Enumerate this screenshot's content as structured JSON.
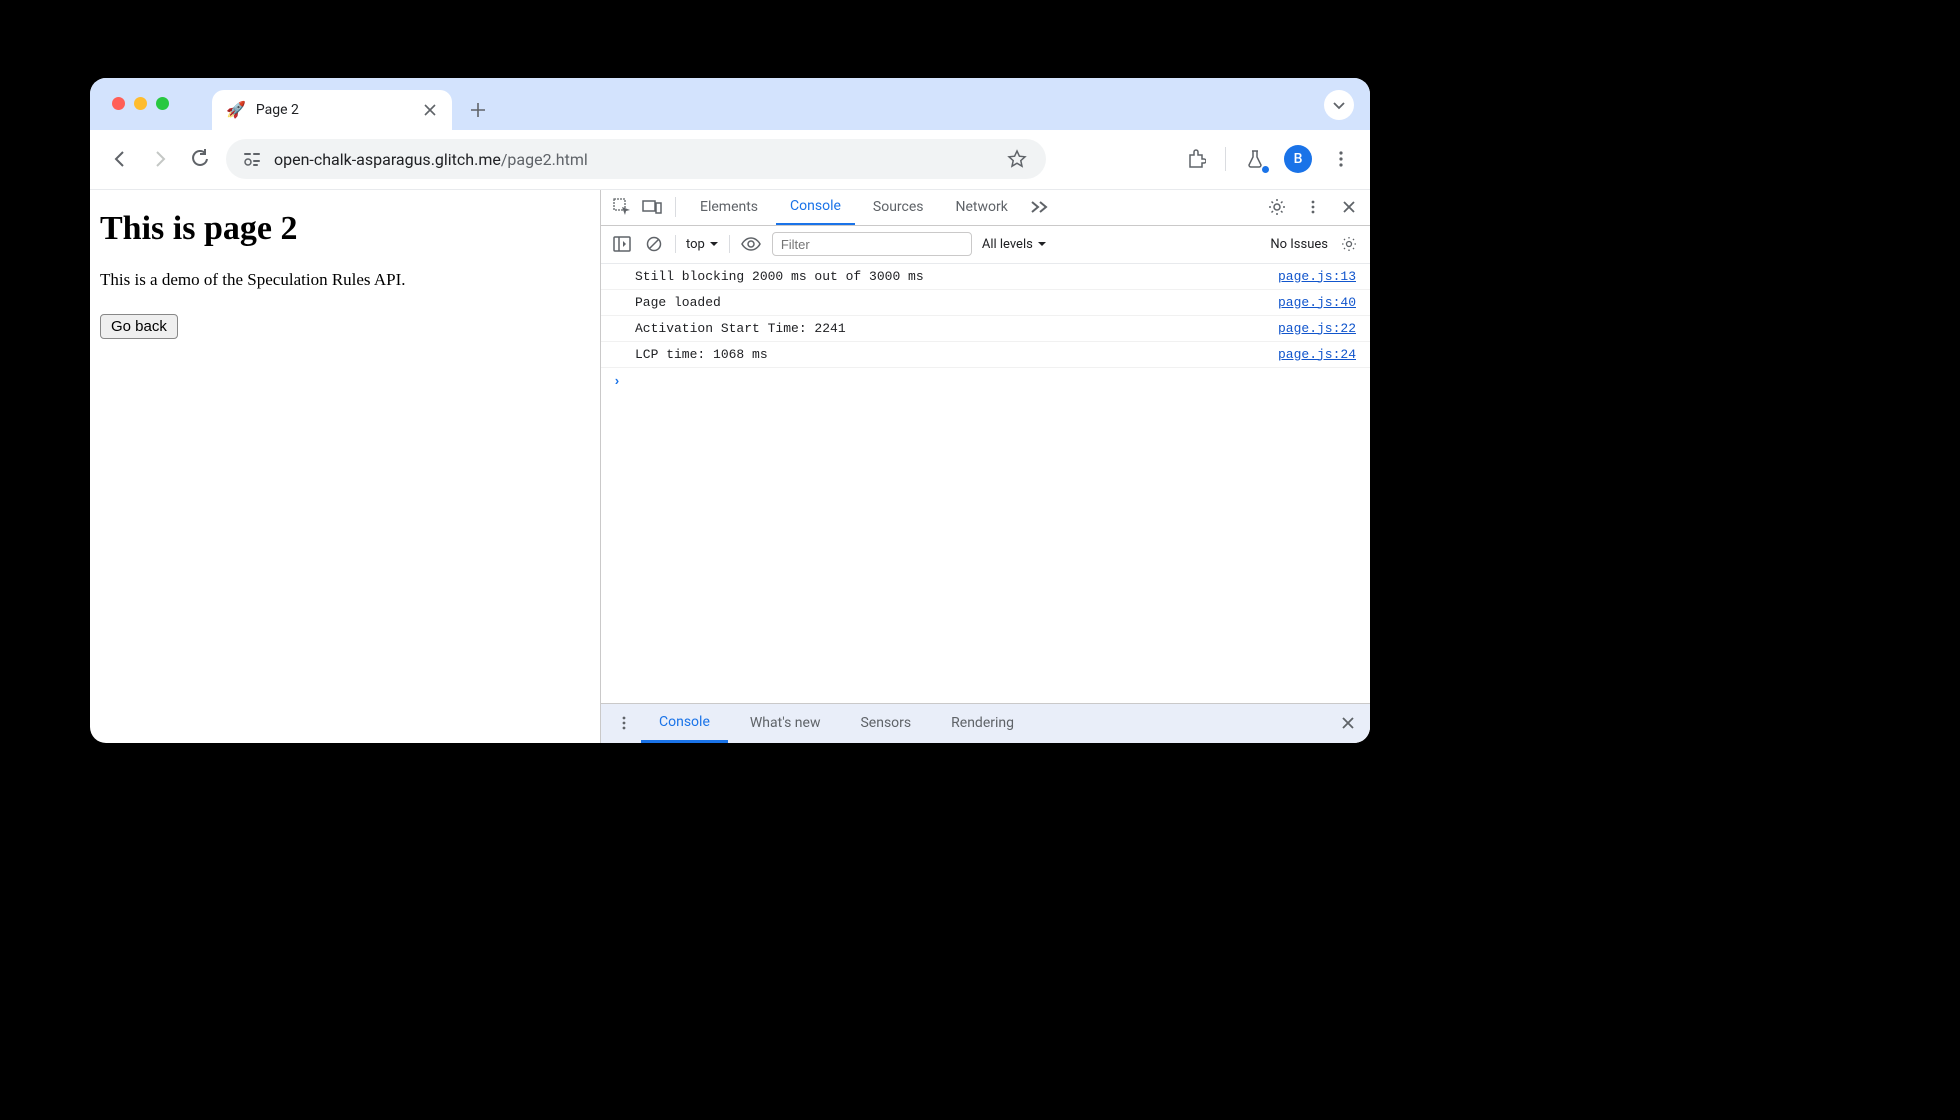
{
  "tab": {
    "title": "Page 2",
    "icon": "🚀"
  },
  "url": {
    "host": "open-chalk-asparagus.glitch.me",
    "path": "/page2.html"
  },
  "avatar_letter": "B",
  "page": {
    "heading": "This is page 2",
    "paragraph": "This is a demo of the Speculation Rules API.",
    "button": "Go back"
  },
  "devtools": {
    "tabs": [
      "Elements",
      "Console",
      "Sources",
      "Network"
    ],
    "active_tab": "Console",
    "console_toolbar": {
      "context": "top",
      "filter_placeholder": "Filter",
      "levels": "All levels",
      "issues": "No Issues"
    },
    "console_rows": [
      {
        "msg": "Still blocking 2000 ms out of 3000 ms",
        "src": "page.js:13"
      },
      {
        "msg": "Page loaded",
        "src": "page.js:40"
      },
      {
        "msg": "Activation Start Time: 2241",
        "src": "page.js:22"
      },
      {
        "msg": "LCP time: 1068 ms",
        "src": "page.js:24"
      }
    ],
    "drawer_tabs": [
      "Console",
      "What's new",
      "Sensors",
      "Rendering"
    ],
    "drawer_active": "Console"
  }
}
